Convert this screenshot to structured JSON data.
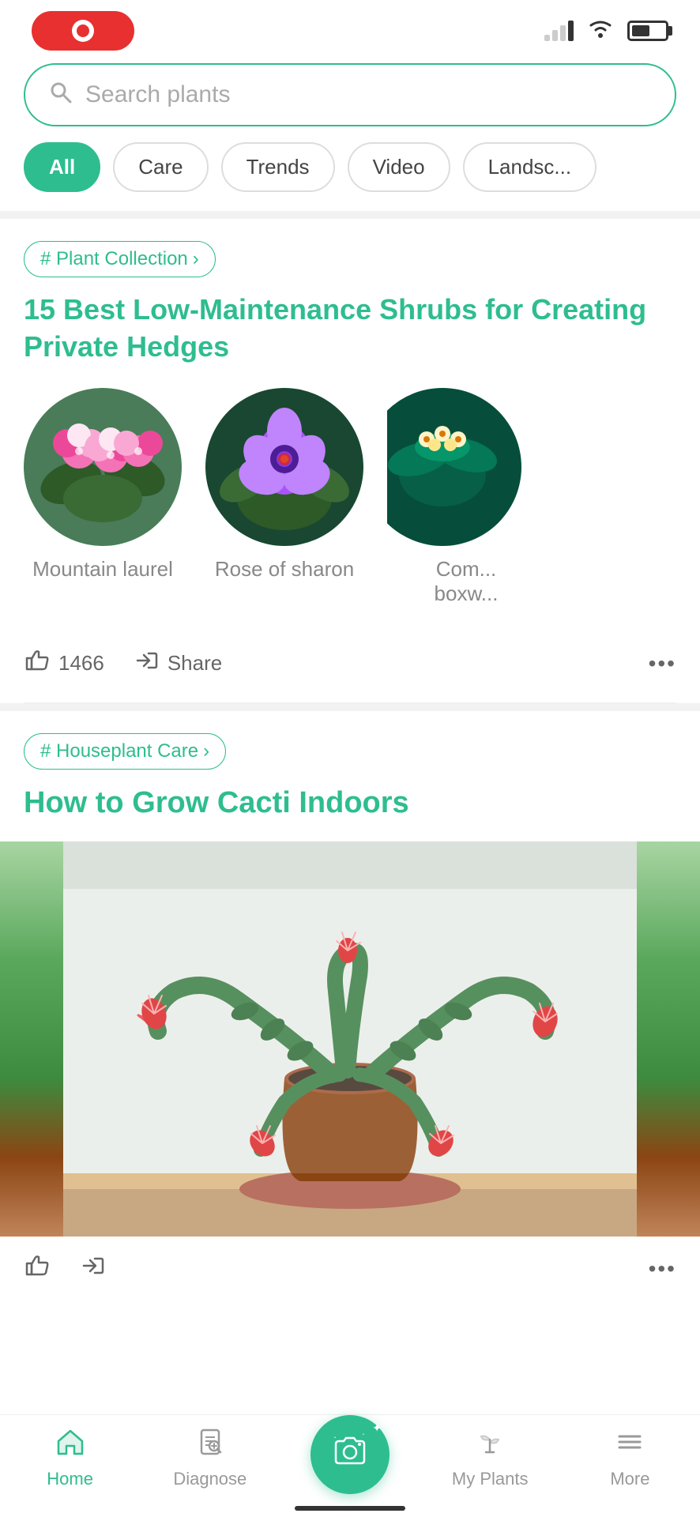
{
  "statusBar": {
    "signalBars": [
      {
        "height": 8,
        "filled": false
      },
      {
        "height": 14,
        "filled": false
      },
      {
        "height": 20,
        "filled": false
      },
      {
        "height": 26,
        "filled": true
      }
    ],
    "batteryLevel": 55
  },
  "search": {
    "placeholder": "Search plants"
  },
  "filterTabs": [
    {
      "label": "All",
      "active": true
    },
    {
      "label": "Care",
      "active": false
    },
    {
      "label": "Trends",
      "active": false
    },
    {
      "label": "Video",
      "active": false
    },
    {
      "label": "Landsc...",
      "active": false
    }
  ],
  "post1": {
    "tag": "# Plant Collection",
    "title": "15 Best Low-Maintenance Shrubs for Creating Private Hedges",
    "plants": [
      {
        "name": "Mountain laurel"
      },
      {
        "name": "Rose of sharon"
      },
      {
        "name": "Com...\nboxw..."
      }
    ],
    "likes": "1466",
    "likeLabel": "1466",
    "shareLabel": "Share",
    "moreLabel": "•••"
  },
  "post2": {
    "tag": "# Houseplant Care",
    "title": "How to Grow Cacti Indoors",
    "moreLabel": "•••"
  },
  "bottomNav": {
    "items": [
      {
        "label": "Home",
        "active": true
      },
      {
        "label": "Diagnose",
        "active": false
      },
      {
        "label": "",
        "isCamera": true
      },
      {
        "label": "My Plants",
        "active": false
      },
      {
        "label": "More",
        "active": false
      }
    ]
  }
}
